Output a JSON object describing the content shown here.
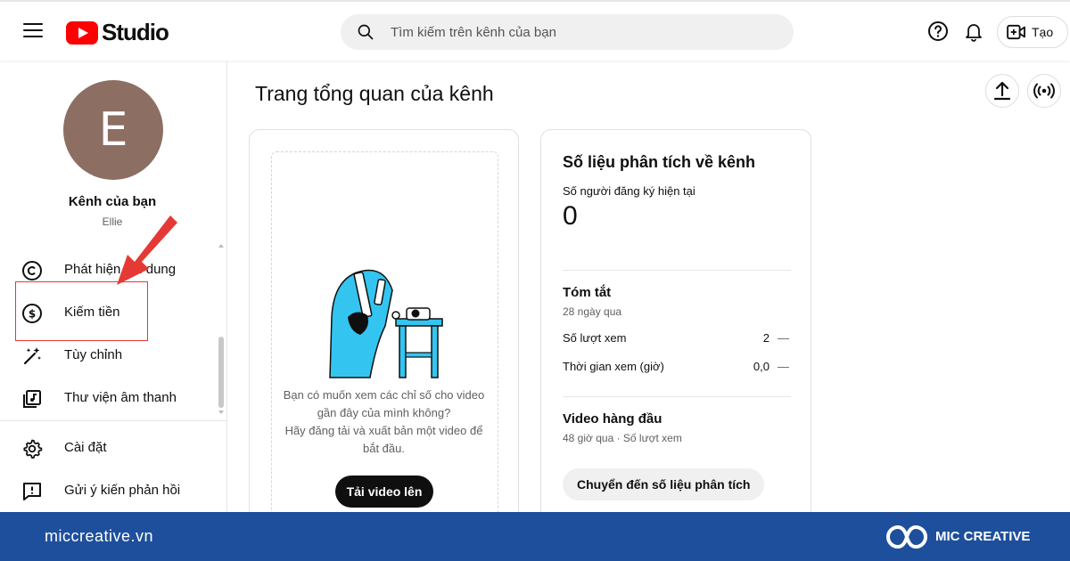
{
  "header": {
    "logo_text": "Studio",
    "search_placeholder": "Tìm kiếm trên kênh của bạn",
    "create_label": "Tạo"
  },
  "sidebar": {
    "avatar_letter": "E",
    "channel_title": "Kênh của bạn",
    "channel_name": "Ellie",
    "items": [
      {
        "label": "Phát hiện nội dung",
        "icon": "copyright-icon"
      },
      {
        "label": "Kiếm tiền",
        "icon": "dollar-icon"
      },
      {
        "label": "Tùy chỉnh",
        "icon": "magic-wand-icon"
      },
      {
        "label": "Thư viện âm thanh",
        "icon": "audio-library-icon"
      }
    ],
    "bottom_items": [
      {
        "label": "Cài đặt",
        "icon": "gear-icon"
      },
      {
        "label": "Gửi ý kiến phản hồi",
        "icon": "feedback-icon"
      }
    ]
  },
  "main": {
    "page_title": "Trang tổng quan của kênh",
    "video_card": {
      "message_lines": [
        "Bạn có muốn xem các chỉ số cho video",
        "gần đây của mình không?",
        "Hãy đăng tải và xuất bản một video để",
        "bắt đầu."
      ],
      "upload_label": "Tải video lên"
    },
    "analytics": {
      "title": "Số liệu phân tích về kênh",
      "subscribers_label": "Số người đăng ký hiện tại",
      "subscribers_value": "0",
      "summary_title": "Tóm tắt",
      "summary_period": "28 ngày qua",
      "views_label": "Số lượt xem",
      "views_value": "2",
      "watch_label": "Thời gian xem (giờ)",
      "watch_value": "0,0",
      "trend_symbol": "—",
      "top_videos_title": "Video hàng đầu",
      "top_videos_period": "48 giờ qua · Số lượt xem",
      "go_analytics_label": "Chuyển đến số liệu phân tích"
    }
  },
  "footer": {
    "url": "miccreative.vn",
    "brand": "MIC CREATIVE"
  },
  "colors": {
    "brand_red": "#ff0000",
    "footer_blue": "#1e4f9c",
    "annotation_red": "#e53935",
    "illustration_cyan": "#33c5f0"
  }
}
